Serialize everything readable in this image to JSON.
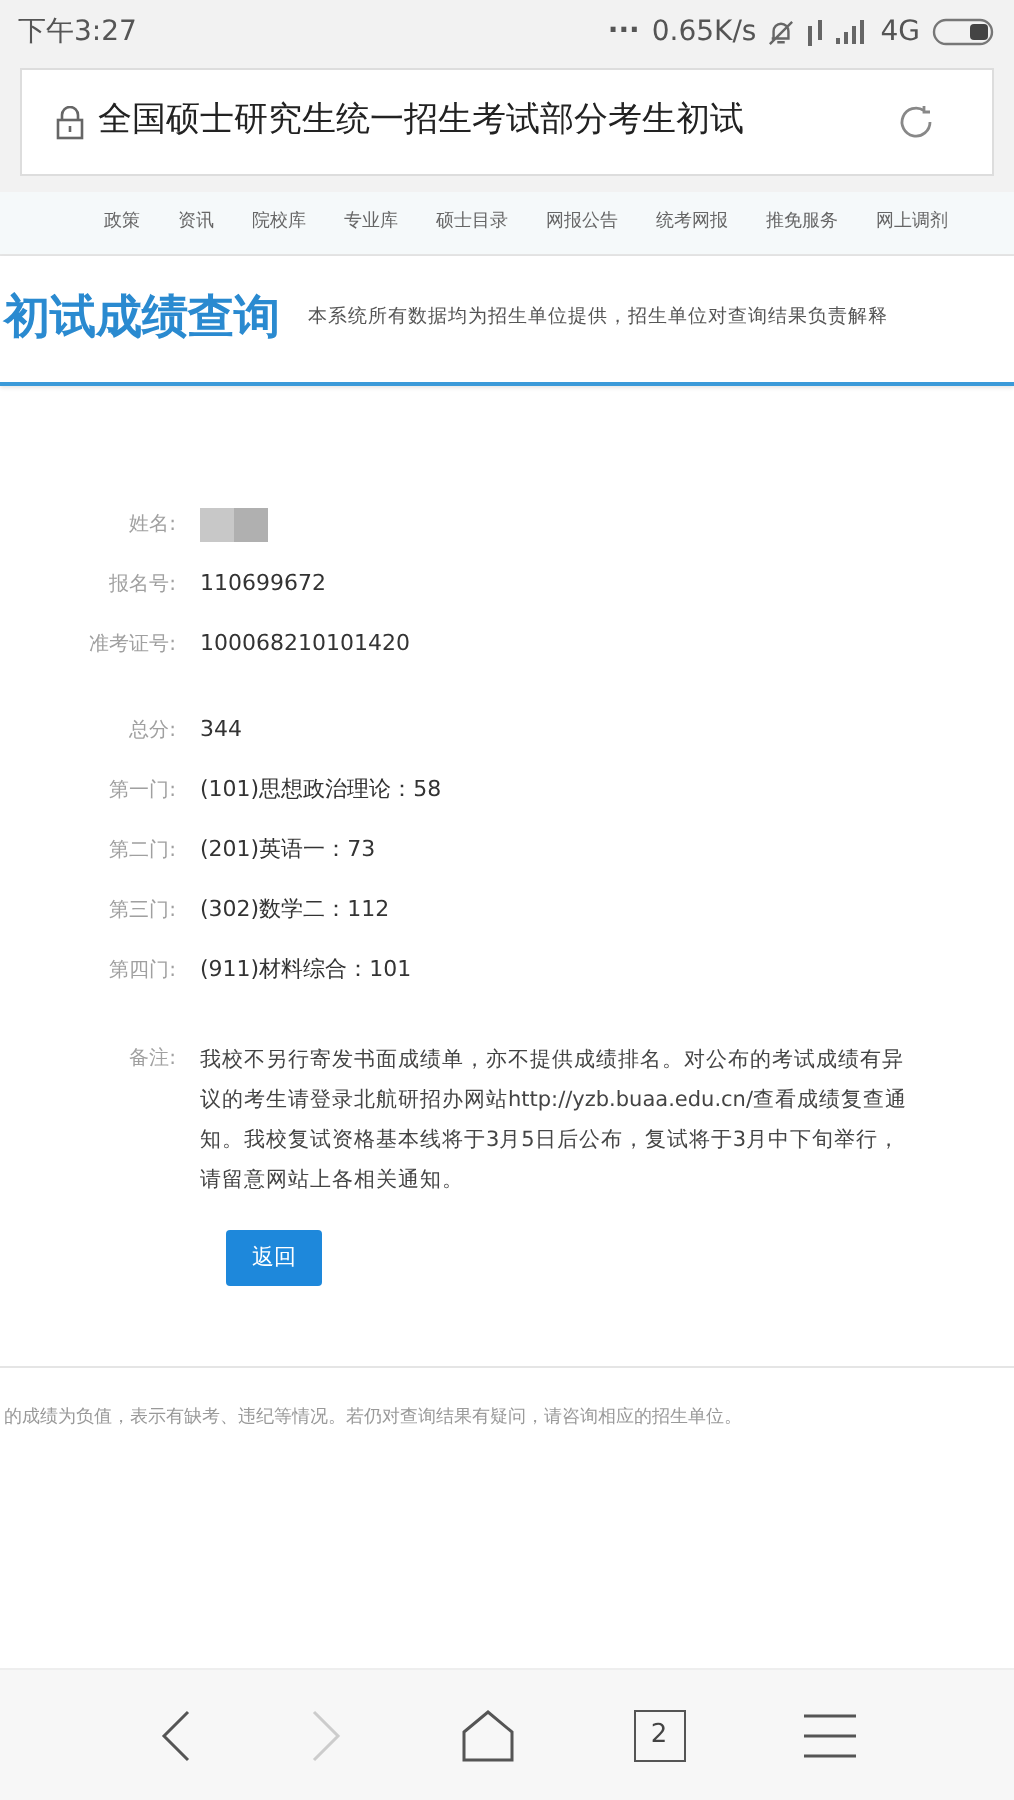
{
  "status_bar": {
    "time": "下午3:27",
    "dots": "...",
    "speed": "0.65K/s",
    "network": "4G"
  },
  "address_bar": {
    "title": "全国硕士研究生统一招生考试部分考生初试"
  },
  "nav": [
    {
      "label": "政策"
    },
    {
      "label": "资讯"
    },
    {
      "label": "院校库"
    },
    {
      "label": "专业库"
    },
    {
      "label": "硕士目录"
    },
    {
      "label": "网报公告"
    },
    {
      "label": "统考网报"
    },
    {
      "label": "推免服务"
    },
    {
      "label": "网上调剂"
    }
  ],
  "header": {
    "title": "初试成绩查询",
    "subtitle": "本系统所有数据均为招生单位提供，招生单位对查询结果负责解释"
  },
  "info_rows": [
    {
      "kind": "redacted",
      "label": "姓名:"
    },
    {
      "kind": "text",
      "label": "报名号:",
      "value": "110699672"
    },
    {
      "kind": "text",
      "label": "准考证号:",
      "value": "100068210101420"
    }
  ],
  "score_rows": [
    {
      "label": "总分:",
      "value": "344"
    },
    {
      "label": "第一门:",
      "value": "(101)思想政治理论：58"
    },
    {
      "label": "第二门:",
      "value": "(201)英语一：73"
    },
    {
      "label": "第三门:",
      "value": "(302)数学二：112"
    },
    {
      "label": "第四门:",
      "value": "(911)材料综合：101"
    }
  ],
  "note": {
    "label": "备注:",
    "text": "我校不另行寄发书面成绩单，亦不提供成绩排名。对公布的考试成绩有异议的考生请登录北航研招办网站http://yzb.buaa.edu.cn/查看成绩复查通知。我校复试资格基本线将于3月5日后公布，复试将于3月中下旬举行，请留意网站上各相关通知。"
  },
  "back_button": "返回",
  "footer_note": "的成绩为负值，表示有缺考、违纪等情况。若仍对查询结果有疑问，请咨询相应的招生单位。",
  "browser_bar": {
    "back_disabled": false,
    "forward_disabled": true,
    "tab_count": "2"
  }
}
